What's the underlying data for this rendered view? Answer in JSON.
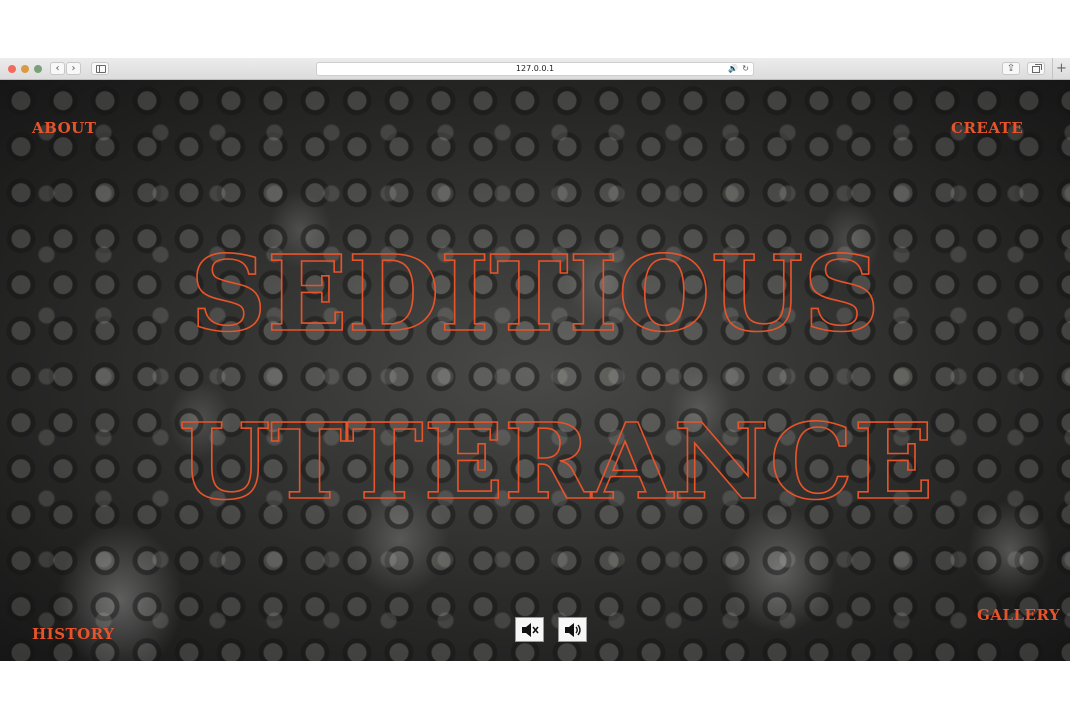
{
  "browser": {
    "url": "127.0.0.1",
    "back_icon": "‹",
    "forward_icon": "›",
    "share_icon": "⇪",
    "new_tab_icon": "+",
    "reload_icon": "↻",
    "audio_icon": "🔊"
  },
  "nav": {
    "about": "ABOUT",
    "create": "CREATE",
    "history": "HISTORY",
    "gallery": "GALLERY"
  },
  "hero": {
    "line1": "SEDITIOUS",
    "line2": "UTTERANCE"
  },
  "controls": {
    "mute_icon": "speaker-muted-icon",
    "unmute_icon": "speaker-on-icon"
  },
  "colors": {
    "accent": "#e8542a",
    "background_photo": "#2b2b2a"
  }
}
